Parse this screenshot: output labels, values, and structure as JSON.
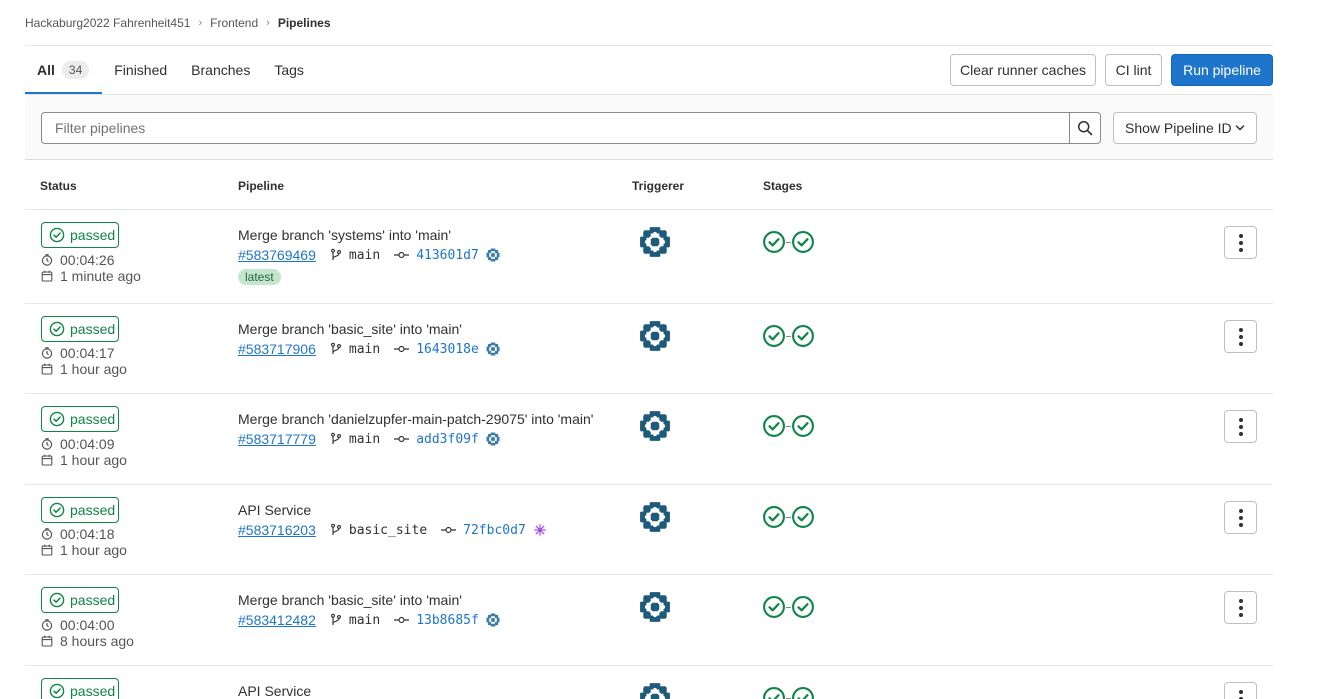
{
  "breadcrumb": [
    "Hackaburg2022 Fahrenheit451",
    "Frontend",
    "Pipelines"
  ],
  "tabs": {
    "all": {
      "label": "All",
      "count": "34"
    },
    "finished": "Finished",
    "branches": "Branches",
    "tags": "Tags"
  },
  "actions": {
    "clear_caches": "Clear runner caches",
    "ci_lint": "CI lint",
    "run_pipeline": "Run pipeline"
  },
  "filter": {
    "placeholder": "Filter pipelines",
    "id_select": "Show Pipeline ID"
  },
  "columns": {
    "status": "Status",
    "pipeline": "Pipeline",
    "triggerer": "Triggerer",
    "stages": "Stages"
  },
  "colors": {
    "accent": "#1f75cb",
    "success": "#108548",
    "latest_bg": "#c3e6cd"
  },
  "pipelines": [
    {
      "status": "passed",
      "duration": "00:04:26",
      "finished": "1 minute ago",
      "title": "Merge branch 'systems' into 'main'",
      "id": "#583769469",
      "ref": "main",
      "sha": "413601d7",
      "latest": "latest"
    },
    {
      "status": "passed",
      "duration": "00:04:17",
      "finished": "1 hour ago",
      "title": "Merge branch 'basic_site' into 'main'",
      "id": "#583717906",
      "ref": "main",
      "sha": "1643018e"
    },
    {
      "status": "passed",
      "duration": "00:04:09",
      "finished": "1 hour ago",
      "title": "Merge branch 'danielzupfer-main-patch-29075' into 'main'",
      "id": "#583717779",
      "ref": "main",
      "sha": "add3f09f"
    },
    {
      "status": "passed",
      "duration": "00:04:18",
      "finished": "1 hour ago",
      "title": "API Service",
      "id": "#583716203",
      "ref": "basic_site",
      "sha": "72fbc0d7"
    },
    {
      "status": "passed",
      "duration": "00:04:00",
      "finished": "8 hours ago",
      "title": "Merge branch 'basic_site' into 'main'",
      "id": "#583412482",
      "ref": "main",
      "sha": "13b8685f"
    },
    {
      "status": "passed",
      "title": "API Service"
    }
  ]
}
